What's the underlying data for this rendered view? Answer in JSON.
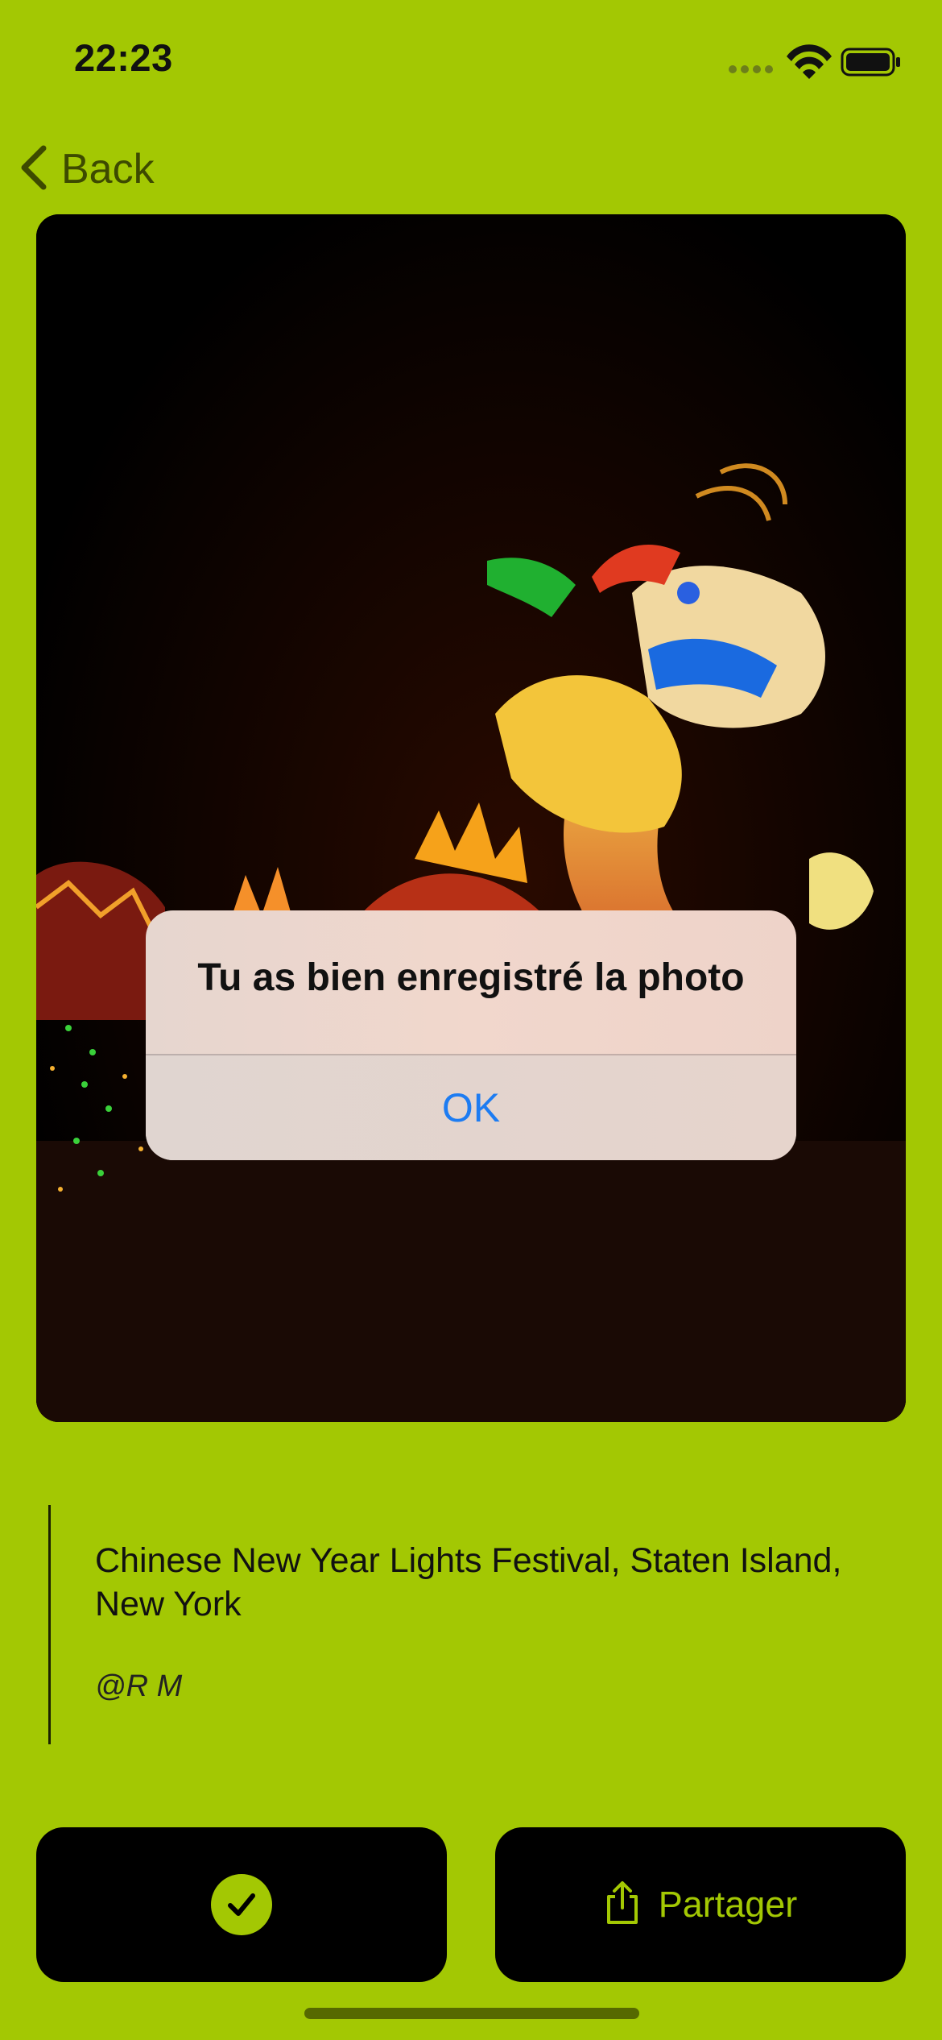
{
  "status_bar": {
    "time": "22:23",
    "icons": [
      "signal-icon",
      "wifi-icon",
      "battery-icon"
    ]
  },
  "nav": {
    "back_label": "Back",
    "back_icon": "chevron-left-icon"
  },
  "photo": {
    "subject": "dragon-lantern"
  },
  "alert": {
    "title": "Tu as bien enregistré la photo",
    "ok_label": "OK"
  },
  "caption": {
    "line1": "Chinese New Year Lights Festival, Staten Island,",
    "line2": "New York",
    "credit": "@R M"
  },
  "actions": {
    "save_icon": "checkmark-circle-icon",
    "share_icon": "share-icon",
    "share_label": "Partager"
  },
  "colors": {
    "background": "#a3c803",
    "accent": "#a3c803",
    "button_bg": "#000000",
    "alert_button_text": "#1d7cf2"
  }
}
